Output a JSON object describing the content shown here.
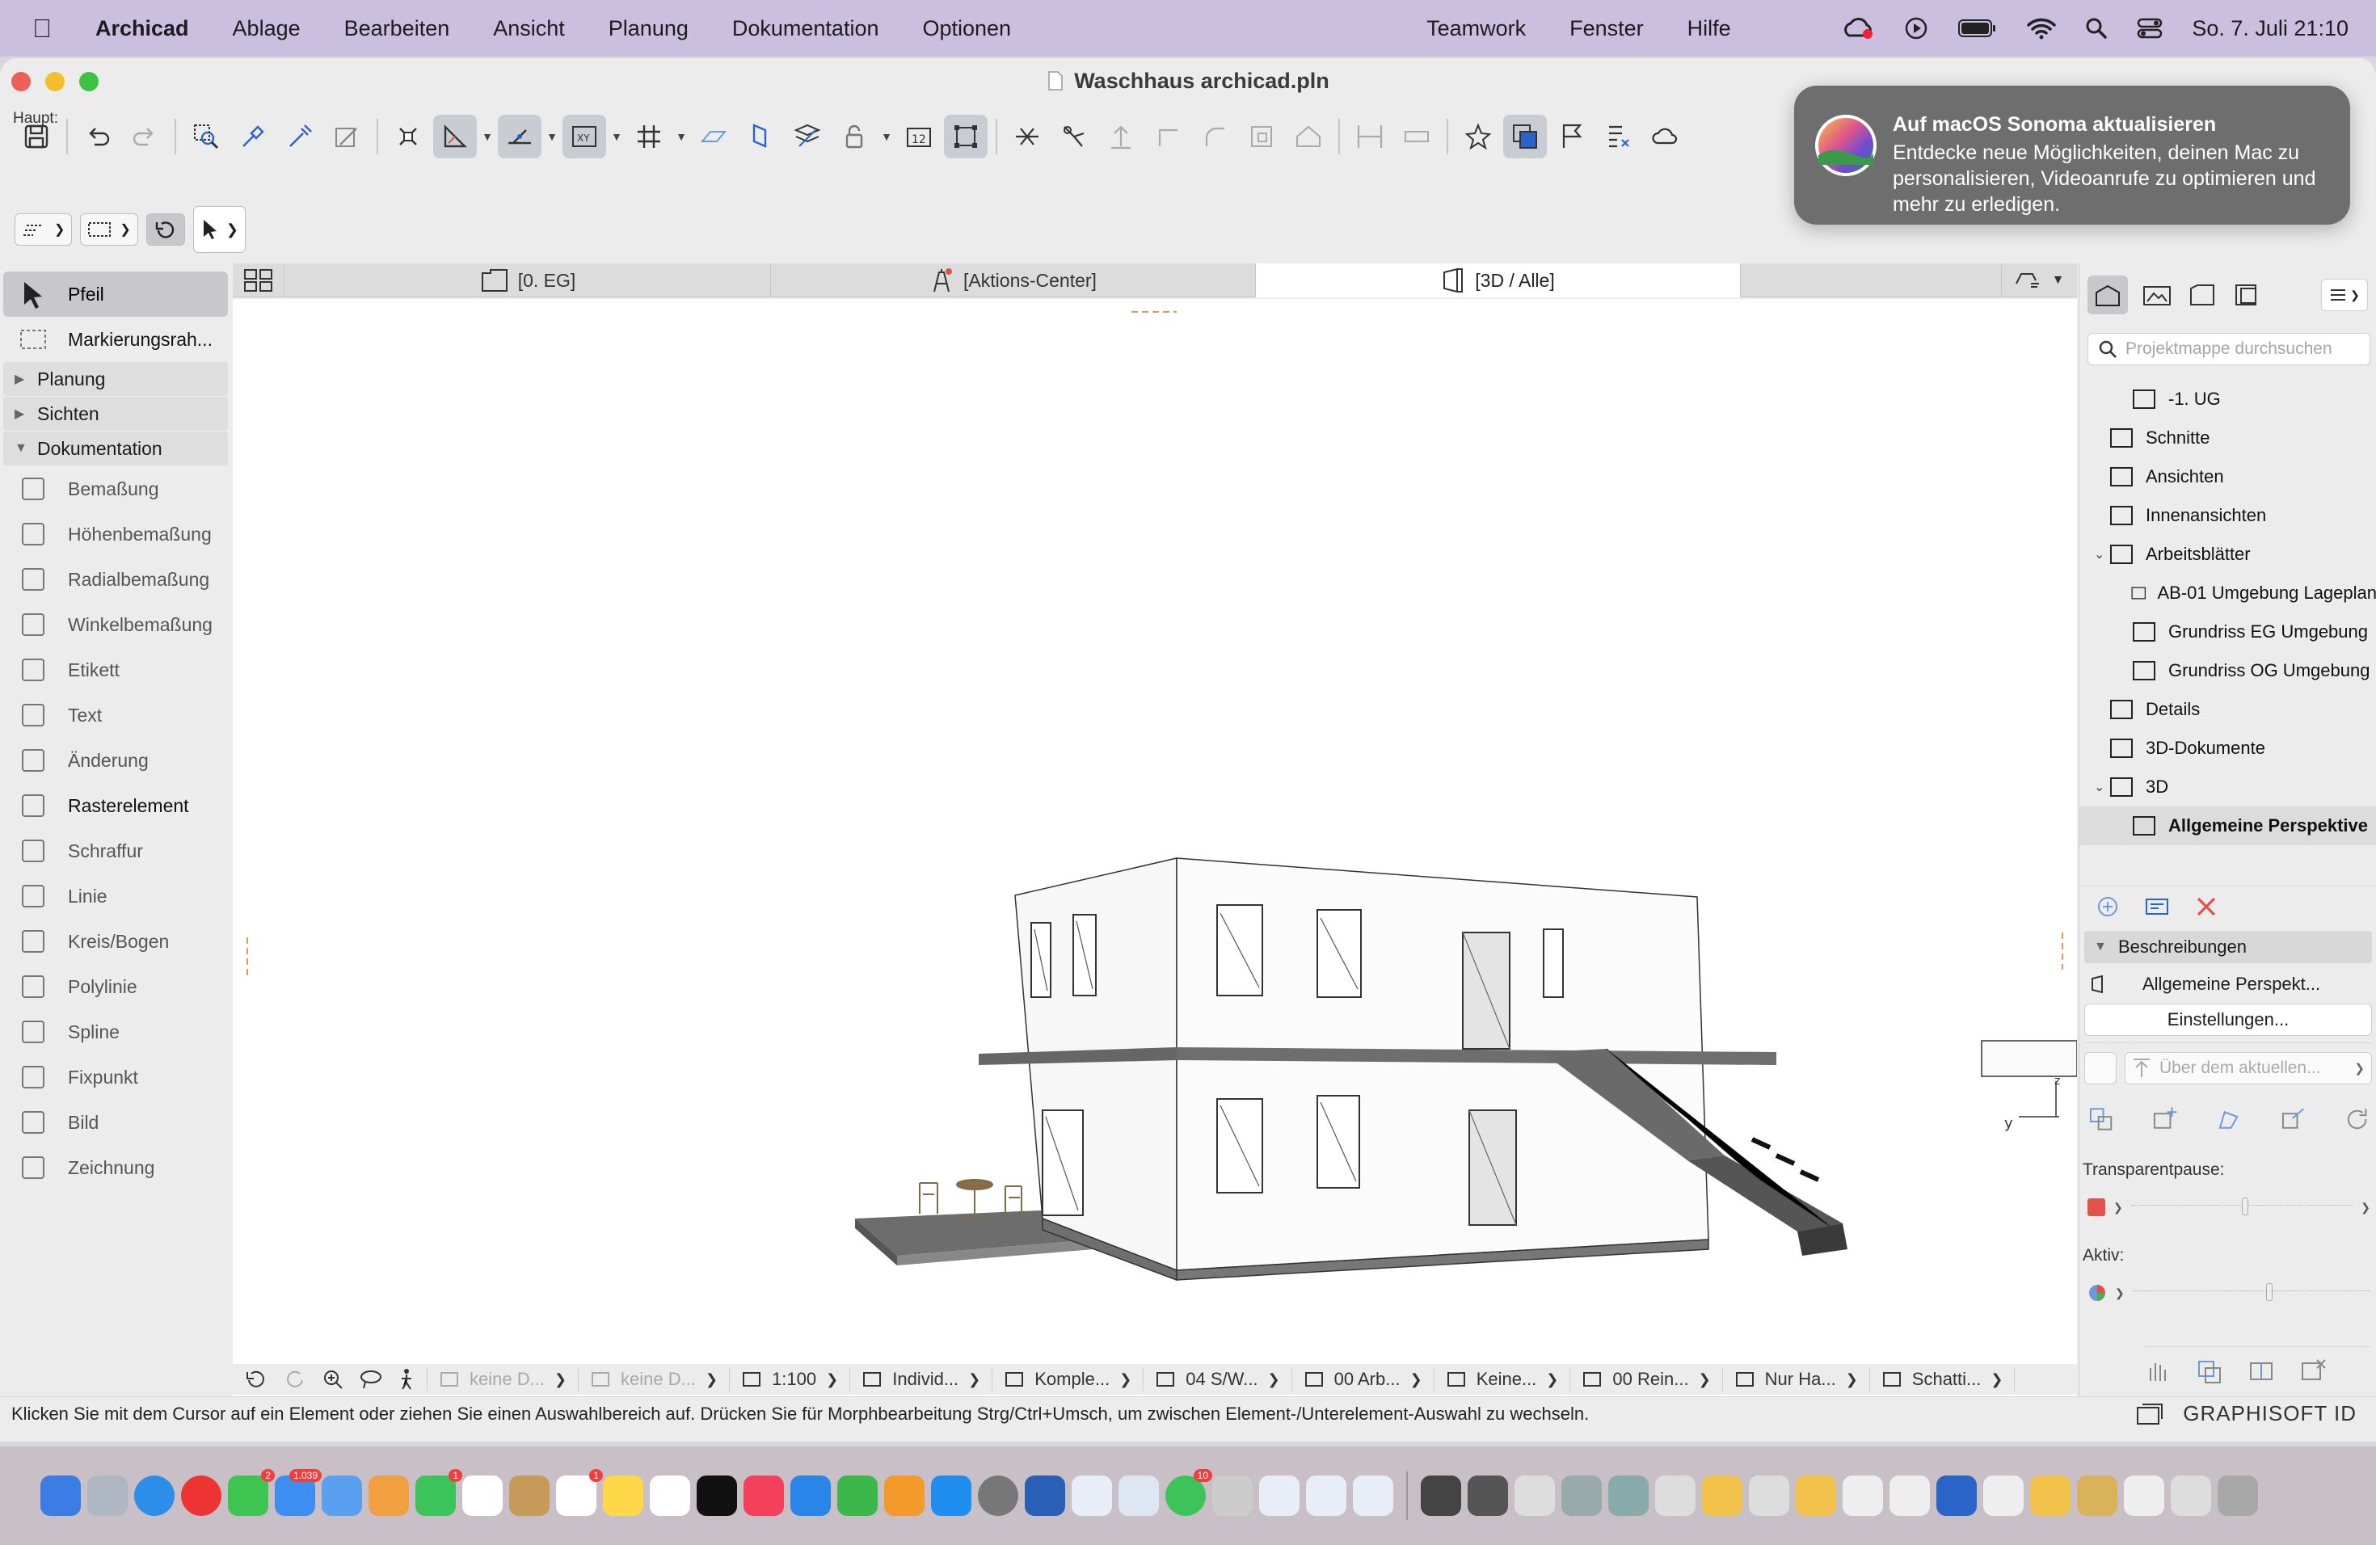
{
  "menubar": {
    "app_name": "Archicad",
    "menus": [
      "Ablage",
      "Bearbeiten",
      "Ansicht",
      "Planung",
      "Dokumentation",
      "Optionen"
    ],
    "menus_right": [
      "Teamwork",
      "Fenster",
      "Hilfe"
    ],
    "clock": "So. 7. Juli  21:10",
    "status_icons": [
      "creative-cloud-icon",
      "play-icon",
      "battery-icon",
      "wifi-icon",
      "search-icon",
      "control-center-icon"
    ]
  },
  "window": {
    "title": "Waschhaus archicad.pln"
  },
  "infobox": {
    "label": "Haupt:"
  },
  "notification": {
    "title": "Auf macOS Sonoma aktualisieren",
    "body": "Entdecke neue Möglichkeiten, deinen Mac zu personalisieren, Videoanrufe zu optimieren und mehr zu erledigen."
  },
  "toolbox": {
    "top_tools": [
      {
        "label": "Pfeil",
        "icon": "arrow-icon",
        "selected": true
      },
      {
        "label": "Markierungsrah...",
        "icon": "marquee-icon",
        "selected": false
      }
    ],
    "groups": [
      {
        "label": "Planung",
        "expanded": false
      },
      {
        "label": "Sichten",
        "expanded": false
      },
      {
        "label": "Dokumentation",
        "expanded": true
      }
    ],
    "doc_tools": [
      {
        "label": "Bemaßung",
        "icon": "dimension-icon"
      },
      {
        "label": "Höhenbemaßung",
        "icon": "level-dimension-icon"
      },
      {
        "label": "Radialbemaßung",
        "icon": "radial-dimension-icon"
      },
      {
        "label": "Winkelbemaßung",
        "icon": "angle-dimension-icon"
      },
      {
        "label": "Etikett",
        "icon": "label-icon"
      },
      {
        "label": "Text",
        "icon": "text-icon"
      },
      {
        "label": "Änderung",
        "icon": "change-icon"
      },
      {
        "label": "Rasterelement",
        "icon": "grid-element-icon"
      },
      {
        "label": "Schraffur",
        "icon": "fill-icon"
      },
      {
        "label": "Linie",
        "icon": "line-icon"
      },
      {
        "label": "Kreis/Bogen",
        "icon": "arc-icon"
      },
      {
        "label": "Polylinie",
        "icon": "polyline-icon"
      },
      {
        "label": "Spline",
        "icon": "spline-icon"
      },
      {
        "label": "Fixpunkt",
        "icon": "hotspot-icon"
      },
      {
        "label": "Bild",
        "icon": "image-icon"
      },
      {
        "label": "Zeichnung",
        "icon": "drawing-icon"
      }
    ]
  },
  "tabs": [
    {
      "label": "[0. EG]",
      "icon": "floorplan-icon",
      "active": false
    },
    {
      "label": "[Aktions-Center]",
      "icon": "action-center-icon",
      "active": false
    },
    {
      "label": "[3D / Alle]",
      "icon": "3d-view-icon",
      "active": true
    }
  ],
  "quick_options": [
    {
      "label": "keine D...",
      "dim": true,
      "icon": "renovation-icon"
    },
    {
      "label": "keine D...",
      "dim": true,
      "icon": "design-option-icon"
    },
    {
      "label": "1:100",
      "dim": false,
      "icon": "scale-icon"
    },
    {
      "label": "Individ...",
      "dim": false,
      "icon": "layer-icon"
    },
    {
      "label": "Komple...",
      "dim": false,
      "icon": "pen-set-icon"
    },
    {
      "label": "04 S/W...",
      "dim": false,
      "icon": "pen-icon"
    },
    {
      "label": "00 Arb...",
      "dim": false,
      "icon": "model-view-icon"
    },
    {
      "label": "Keine...",
      "dim": false,
      "icon": "override-icon"
    },
    {
      "label": "00 Rein...",
      "dim": false,
      "icon": "renovation-filter-icon"
    },
    {
      "label": "Nur Ha...",
      "dim": false,
      "icon": "structure-icon"
    },
    {
      "label": "Schatti...",
      "dim": false,
      "icon": "shading-icon"
    }
  ],
  "status_bar": {
    "message": "Klicken Sie mit dem Cursor auf ein Element oder ziehen Sie einen Auswahlbereich auf. Drücken Sie für Morphbearbeitung Strg/Ctrl+Umsch, um zwischen Element-/Unterelement-Auswahl zu wechseln.",
    "brand": "GRAPHISOFT ID"
  },
  "navigator": {
    "search_placeholder": "Projektmappe durchsuchen",
    "tree": [
      {
        "label": "-1. UG",
        "indent": 2,
        "icon": "story-icon",
        "caret": ""
      },
      {
        "label": "Schnitte",
        "indent": 1,
        "icon": "section-icon",
        "caret": ""
      },
      {
        "label": "Ansichten",
        "indent": 1,
        "icon": "elevation-icon",
        "caret": ""
      },
      {
        "label": "Innenansichten",
        "indent": 1,
        "icon": "interior-elevation-icon",
        "caret": ""
      },
      {
        "label": "Arbeitsblätter",
        "indent": 1,
        "icon": "worksheet-icon",
        "caret": "v"
      },
      {
        "label": "AB-01 Umgebung Lageplan",
        "indent": 2,
        "icon": "worksheet-icon",
        "caret": ""
      },
      {
        "label": "Grundriss EG Umgebung",
        "indent": 2,
        "icon": "worksheet-icon",
        "caret": ""
      },
      {
        "label": "Grundriss OG Umgebung",
        "indent": 2,
        "icon": "worksheet-icon",
        "caret": ""
      },
      {
        "label": "Details",
        "indent": 1,
        "icon": "detail-icon",
        "caret": ""
      },
      {
        "label": "3D-Dokumente",
        "indent": 1,
        "icon": "3d-document-icon",
        "caret": ""
      },
      {
        "label": "3D",
        "indent": 1,
        "icon": "3d-icon",
        "caret": "v"
      },
      {
        "label": "Allgemeine Perspektive",
        "indent": 2,
        "icon": "3d-view-icon",
        "caret": "",
        "selected": true
      }
    ],
    "descriptions_header": "Beschreibungen",
    "description_value": "Allgemeine Perspekt...",
    "settings_button": "Einstellungen...",
    "about_button": "Über dem aktuellen...",
    "transparency_label": "Transparentpause:",
    "active_label": "Aktiv:"
  },
  "dock": {
    "badges": {
      "mail": "1.039",
      "messages": "2",
      "facetime": "1",
      "reminders": "1",
      "whatsapp": "10"
    }
  },
  "colors": {
    "menubar": "#cbbfe0",
    "accent_red": "#e2514a",
    "selection": "#c8c8cc"
  }
}
